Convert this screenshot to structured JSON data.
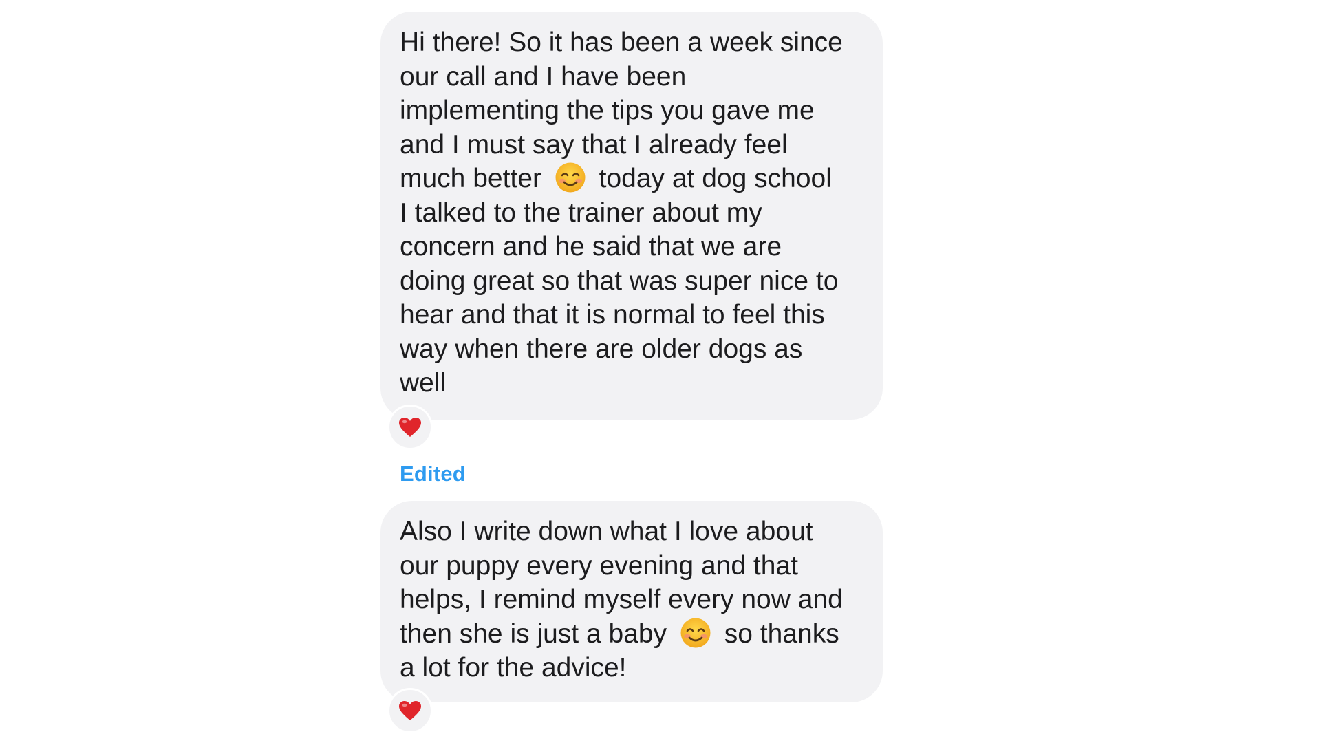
{
  "messages": [
    {
      "lines": [
        {
          "text": "Hi there! So it has been a week since"
        },
        {
          "text": "our call and I have been"
        },
        {
          "text": "implementing the tips you gave me"
        },
        {
          "text": "and I must say that I already feel"
        },
        {
          "before": "much better",
          "emoji": "smiling-face-emoji",
          "after": "today at dog school"
        },
        {
          "text": "I talked to the trainer about my"
        },
        {
          "text": "concern and he said that we are"
        },
        {
          "text": "doing great so that was super nice to"
        },
        {
          "text": "hear and that it is normal to feel this"
        },
        {
          "text": "way when there are older dogs as"
        },
        {
          "text": "well"
        }
      ],
      "reaction": "heart-icon"
    },
    {
      "status": "Edited",
      "lines": [
        {
          "text": "Also I write down what I love about"
        },
        {
          "text": "our puppy every evening and that"
        },
        {
          "text": "helps, I remind myself every now and"
        },
        {
          "before": "then she is just a baby",
          "emoji": "smiling-face-emoji",
          "after": "so thanks"
        },
        {
          "text": "a lot for the advice!"
        }
      ],
      "reaction": "heart-icon"
    }
  ],
  "colors": {
    "bubble": "#f2f2f4",
    "text": "#1c1c1e",
    "edited": "#2e9bf0",
    "heart": "#e0252b"
  }
}
